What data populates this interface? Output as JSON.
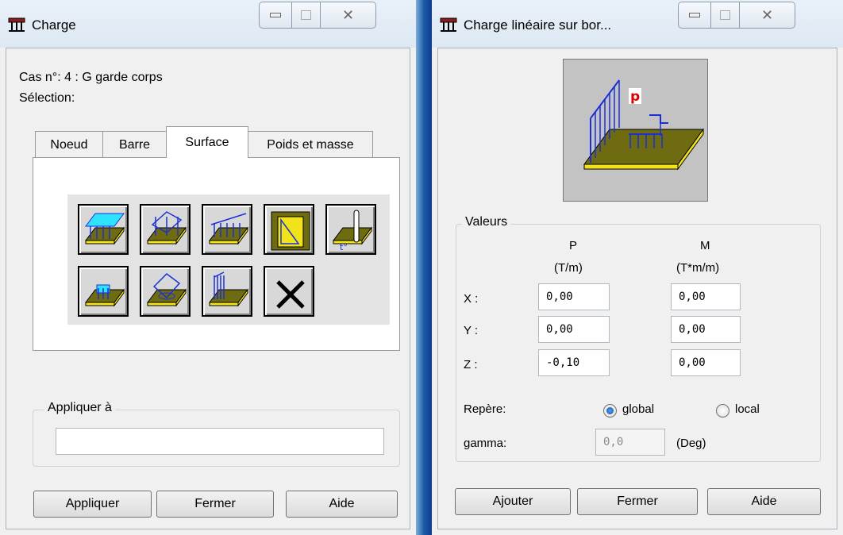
{
  "left_window": {
    "title": "Charge",
    "case_line": "Cas n°: 4 : G garde corps",
    "selection_label": "Sélection:",
    "tabs": [
      "Noeud",
      "Barre",
      "Surface",
      "Poids et masse"
    ],
    "active_tab": "Surface",
    "icons": [
      "uniform-surface-load-icon",
      "point-load-on-surface-icon",
      "linear-load-on-surface-icon",
      "hydrostatic-pressure-icon",
      "thermal-load-icon",
      "local-surface-load-icon",
      "point-load-on-contour-icon",
      "linear-load-on-edge-icon",
      "delete-load-icon"
    ],
    "apply_group_label": "Appliquer à",
    "apply_input_value": "",
    "buttons": {
      "apply": "Appliquer",
      "close": "Fermer",
      "help": "Aide"
    }
  },
  "right_window": {
    "title": "Charge linéaire sur bor...",
    "preview_label": "p",
    "values_group_label": "Valeurs",
    "col_p": {
      "name": "P",
      "unit": "(T/m)"
    },
    "col_m": {
      "name": "M",
      "unit": "(T*m/m)"
    },
    "rows": [
      {
        "label": "X :",
        "p": "0,00",
        "m": "0,00"
      },
      {
        "label": "Y :",
        "p": "0,00",
        "m": "0,00"
      },
      {
        "label": "Z :",
        "p": "-0,10",
        "m": "0,00"
      }
    ],
    "repere_label": "Repère:",
    "radio_global": "global",
    "radio_local": "local",
    "repere_selected": "global",
    "gamma_label": "gamma:",
    "gamma_value": "0,0",
    "gamma_unit": "(Deg)",
    "buttons": {
      "add": "Ajouter",
      "close": "Fermer",
      "help": "Aide"
    }
  },
  "colors": {
    "load_blue": "#1a2fd8",
    "slab_olive": "#6e6b10",
    "slab_edge": "#f2e21a",
    "cyan": "#2fe2ff"
  }
}
